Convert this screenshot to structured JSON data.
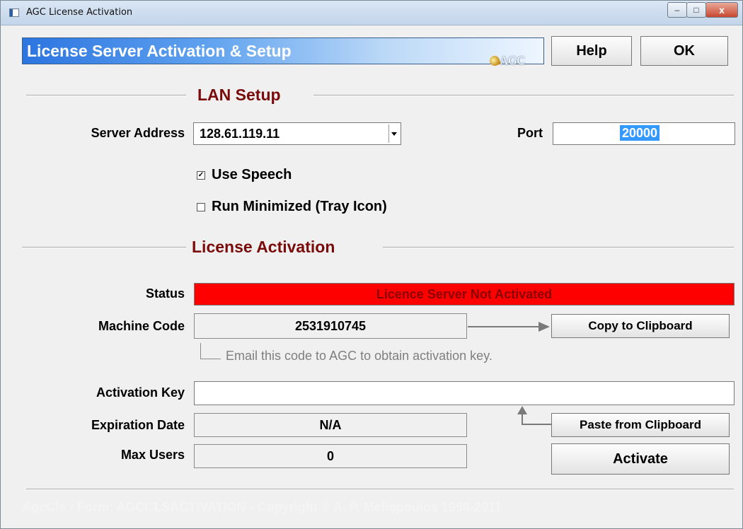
{
  "window": {
    "title": "AGC License Activation",
    "controls": {
      "minimize": "–",
      "maximize": "□",
      "close": "x"
    }
  },
  "header": {
    "banner_title": "License Server Activation & Setup",
    "logo_text": "AGC",
    "help_label": "Help",
    "ok_label": "OK"
  },
  "lan_setup": {
    "section_title": "LAN Setup",
    "server_address_label": "Server Address",
    "server_address_value": "128.61.119.11",
    "port_label": "Port",
    "port_value": "20000",
    "use_speech_label": "Use Speech",
    "use_speech_checked": true,
    "run_minimized_label": "Run Minimized (Tray Icon)",
    "run_minimized_checked": false
  },
  "license_activation": {
    "section_title": "License Activation",
    "status_label": "Status",
    "status_value": "Licence Server Not Activated",
    "status_color": "#ff0000",
    "machine_code_label": "Machine Code",
    "machine_code_value": "2531910745",
    "copy_button_label": "Copy to Clipboard",
    "hint_text": "Email this code to AGC to obtain activation key.",
    "activation_key_label": "Activation Key",
    "activation_key_value": "",
    "paste_button_label": "Paste from Clipboard",
    "expiration_label": "Expiration Date",
    "expiration_value": "N/A",
    "max_users_label": "Max Users",
    "max_users_value": "0",
    "activate_button_label": "Activate"
  },
  "footer": {
    "text": "AgcCls - Form: AGCCLSACTIVATION - Copyright © A. P. Meliopoulos 1998-2011"
  },
  "colors": {
    "section_title": "#7a0b0b",
    "banner_start": "#2c75e0",
    "selection": "#3399ff"
  }
}
